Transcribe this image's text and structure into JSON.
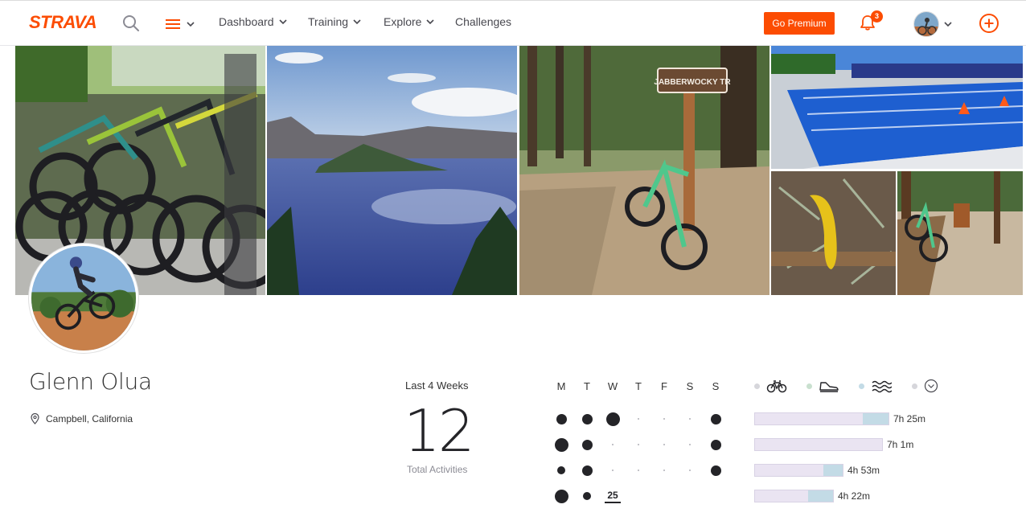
{
  "brand": {
    "logo_text": "STRAVA",
    "accent_color": "#fc4c02"
  },
  "nav": {
    "items": [
      {
        "label": "Dashboard",
        "has_dropdown": true
      },
      {
        "label": "Training",
        "has_dropdown": true
      },
      {
        "label": "Explore",
        "has_dropdown": true
      },
      {
        "label": "Challenges",
        "has_dropdown": false
      }
    ],
    "premium_button": "Go Premium",
    "notification_count": "3",
    "icons": [
      "search-icon",
      "menu-icon",
      "bell-icon",
      "avatar",
      "plus-circle-icon"
    ]
  },
  "banner": {
    "photos": [
      "bikes-on-rack",
      "crater-lake",
      "jabberwocky-trail-sign",
      "swimming-pool",
      "yellow-banana-slug",
      "bike-on-forest-trail"
    ],
    "trail_sign_text": "JABBERWOCKY TR"
  },
  "athlete": {
    "name": "Glenn Olua",
    "location": "Campbell, California"
  },
  "stats": {
    "period_label": "Last 4 Weeks",
    "total_activities": "12",
    "total_activities_label": "Total Activities"
  },
  "calendar": {
    "day_headers": [
      "M",
      "T",
      "W",
      "T",
      "F",
      "S",
      "S"
    ],
    "weeks": [
      [
        "md",
        "md",
        "lg",
        "none",
        "none",
        "none",
        "md"
      ],
      [
        "lg",
        "md",
        "none",
        "none",
        "none",
        "none",
        "md"
      ],
      [
        "sm",
        "md",
        "none",
        "none",
        "none",
        "none",
        "md"
      ],
      [
        "lg",
        "sm",
        "today",
        "",
        "",
        "",
        ""
      ]
    ],
    "today_label": "25"
  },
  "sport_tabs": [
    {
      "name": "ride",
      "icon": "bike-icon"
    },
    {
      "name": "run",
      "icon": "shoe-icon"
    },
    {
      "name": "swim",
      "icon": "swim-icon"
    },
    {
      "name": "more",
      "icon": "chevron-circle-icon"
    }
  ],
  "weekly_totals": [
    {
      "label": "7h 25m",
      "fraction": 1.0,
      "fill_fraction": 0.19
    },
    {
      "label": "7h 1m",
      "fraction": 0.95,
      "fill_fraction": 0.0
    },
    {
      "label": "4h 53m",
      "fraction": 0.66,
      "fill_fraction": 0.22
    },
    {
      "label": "4h 22m",
      "fraction": 0.59,
      "fill_fraction": 0.31
    }
  ]
}
